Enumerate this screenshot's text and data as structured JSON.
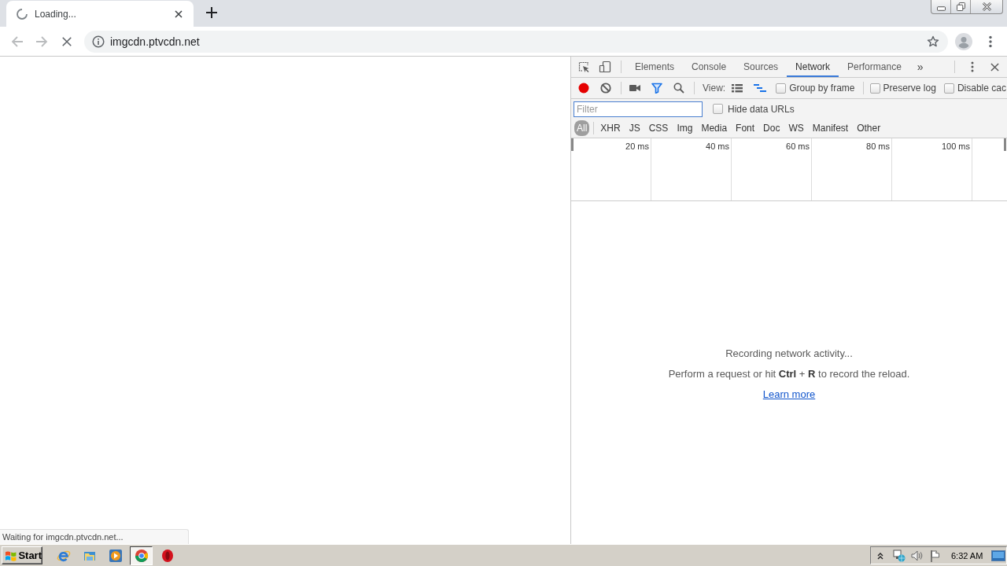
{
  "browser": {
    "tab": {
      "title": "Loading...",
      "loading": true
    },
    "address_bar": {
      "url": "imgcdn.ptvcdn.net"
    },
    "status_bubble": "Waiting for imgcdn.ptvcdn.net..."
  },
  "devtools": {
    "tabs": [
      {
        "label": "Elements",
        "selected": false
      },
      {
        "label": "Console",
        "selected": false
      },
      {
        "label": "Sources",
        "selected": false
      },
      {
        "label": "Network",
        "selected": true
      },
      {
        "label": "Performance",
        "selected": false
      }
    ],
    "more_tabs": "»",
    "recording": true,
    "filter_active": true,
    "overview_shown": true,
    "view_label": "View:",
    "options": [
      {
        "label": "Group by frame",
        "checked": false
      },
      {
        "label": "Preserve log",
        "checked": false
      },
      {
        "label": "Disable cac",
        "checked": false
      }
    ],
    "filter": {
      "placeholder": "Filter",
      "focused": true
    },
    "hide_data_urls": {
      "label": "Hide data URLs",
      "checked": false
    },
    "types": [
      {
        "label": "All",
        "selected": true
      },
      {
        "label": "XHR",
        "selected": false
      },
      {
        "label": "JS",
        "selected": false
      },
      {
        "label": "CSS",
        "selected": false
      },
      {
        "label": "Img",
        "selected": false
      },
      {
        "label": "Media",
        "selected": false
      },
      {
        "label": "Font",
        "selected": false
      },
      {
        "label": "Doc",
        "selected": false
      },
      {
        "label": "WS",
        "selected": false
      },
      {
        "label": "Manifest",
        "selected": false
      },
      {
        "label": "Other",
        "selected": false
      }
    ],
    "overview": {
      "ticks": [
        "20 ms",
        "40 ms",
        "60 ms",
        "80 ms",
        "100 ms"
      ]
    },
    "empty_state": {
      "title": "Recording network activity...",
      "hint": "Perform a request or hit **Ctrl** + **R** to record the reload.",
      "link": "Learn more"
    }
  },
  "taskbar": {
    "start": "Start",
    "apps": [
      {
        "kind": "ie",
        "active": false
      },
      {
        "kind": "explorer",
        "active": false
      },
      {
        "kind": "media",
        "active": false
      },
      {
        "kind": "chrome",
        "active": true
      },
      {
        "kind": "opera",
        "active": false
      }
    ],
    "clock": "6:32 AM"
  }
}
